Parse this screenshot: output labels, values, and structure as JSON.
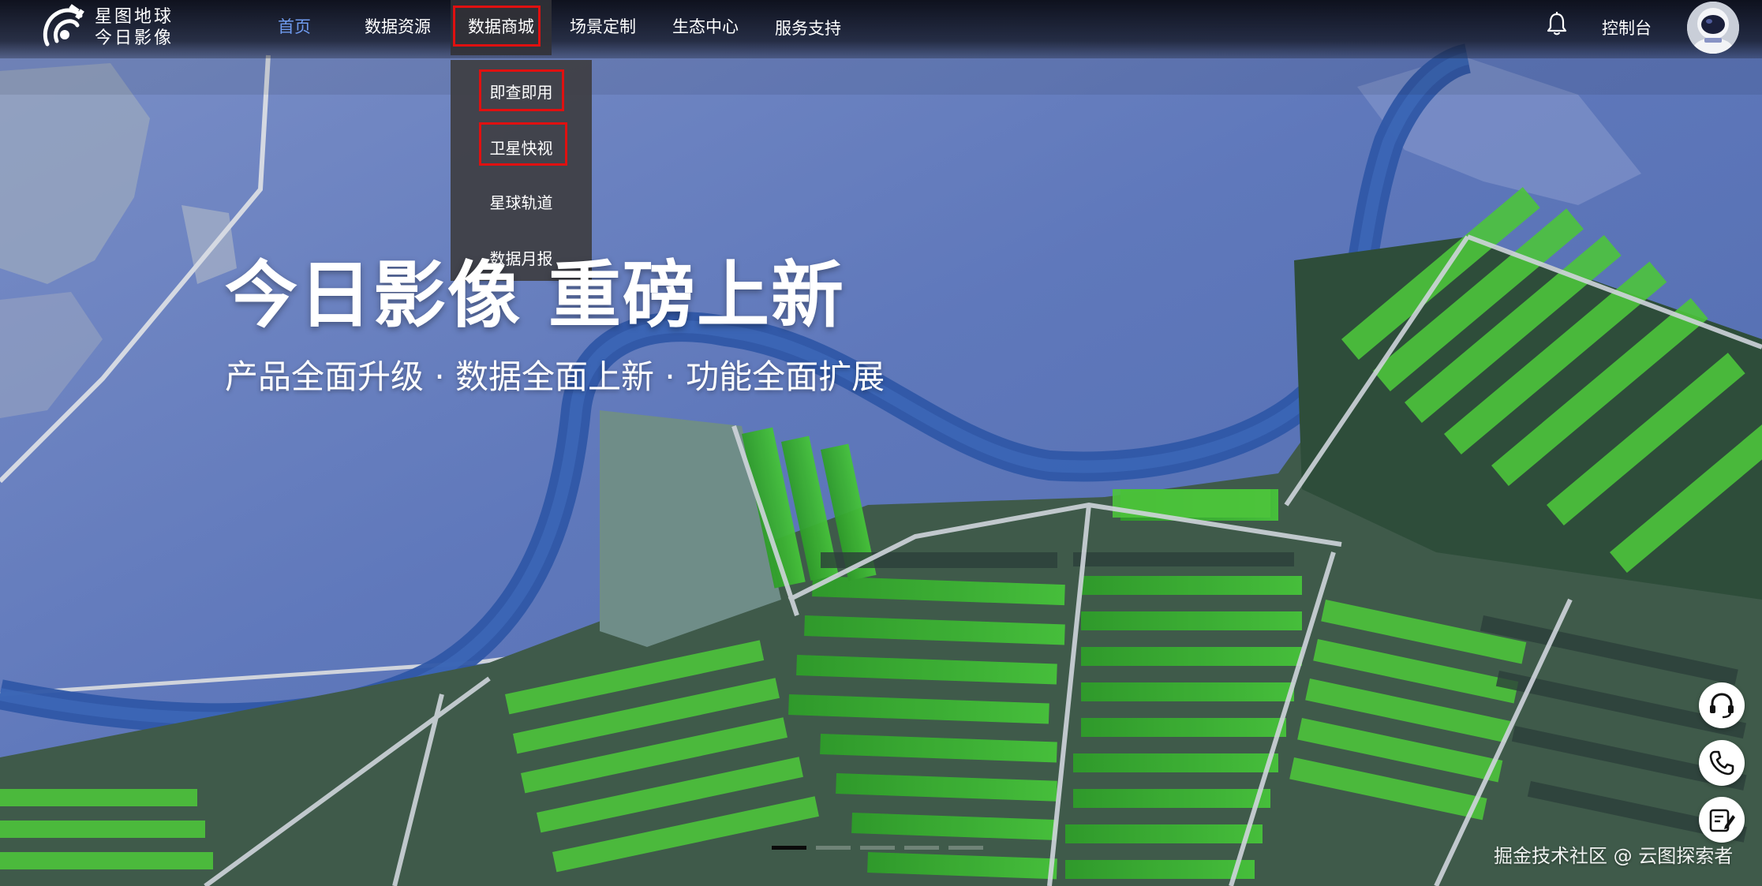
{
  "brand": {
    "line1": "星图地球",
    "line2": "今日影像"
  },
  "nav": {
    "items": [
      {
        "label": "首页"
      },
      {
        "label": "数据资源"
      },
      {
        "label": "数据商城"
      },
      {
        "label": "场景定制"
      },
      {
        "label": "生态中心"
      },
      {
        "label": "服务支持"
      }
    ],
    "active_index": 0,
    "open_index": 2,
    "console_label": "控制台"
  },
  "dropdown": {
    "items": [
      {
        "label": "即查即用"
      },
      {
        "label": "卫星快视"
      },
      {
        "label": "星球轨道"
      },
      {
        "label": "数据月报"
      }
    ]
  },
  "hero": {
    "title": "今日影像 重磅上新",
    "subtitle": "产品全面升级 · 数据全面上新 · 功能全面扩展"
  },
  "carousel": {
    "slide_count": 5,
    "active_index": 0
  },
  "float_buttons": [
    {
      "icon": "headset-icon"
    },
    {
      "icon": "phone-icon"
    },
    {
      "icon": "edit-note-icon"
    }
  ],
  "watermark": "掘金技术社区 @ 云图探索者",
  "colors": {
    "active_nav": "#6f9bef",
    "highlight_box": "#e01010"
  }
}
